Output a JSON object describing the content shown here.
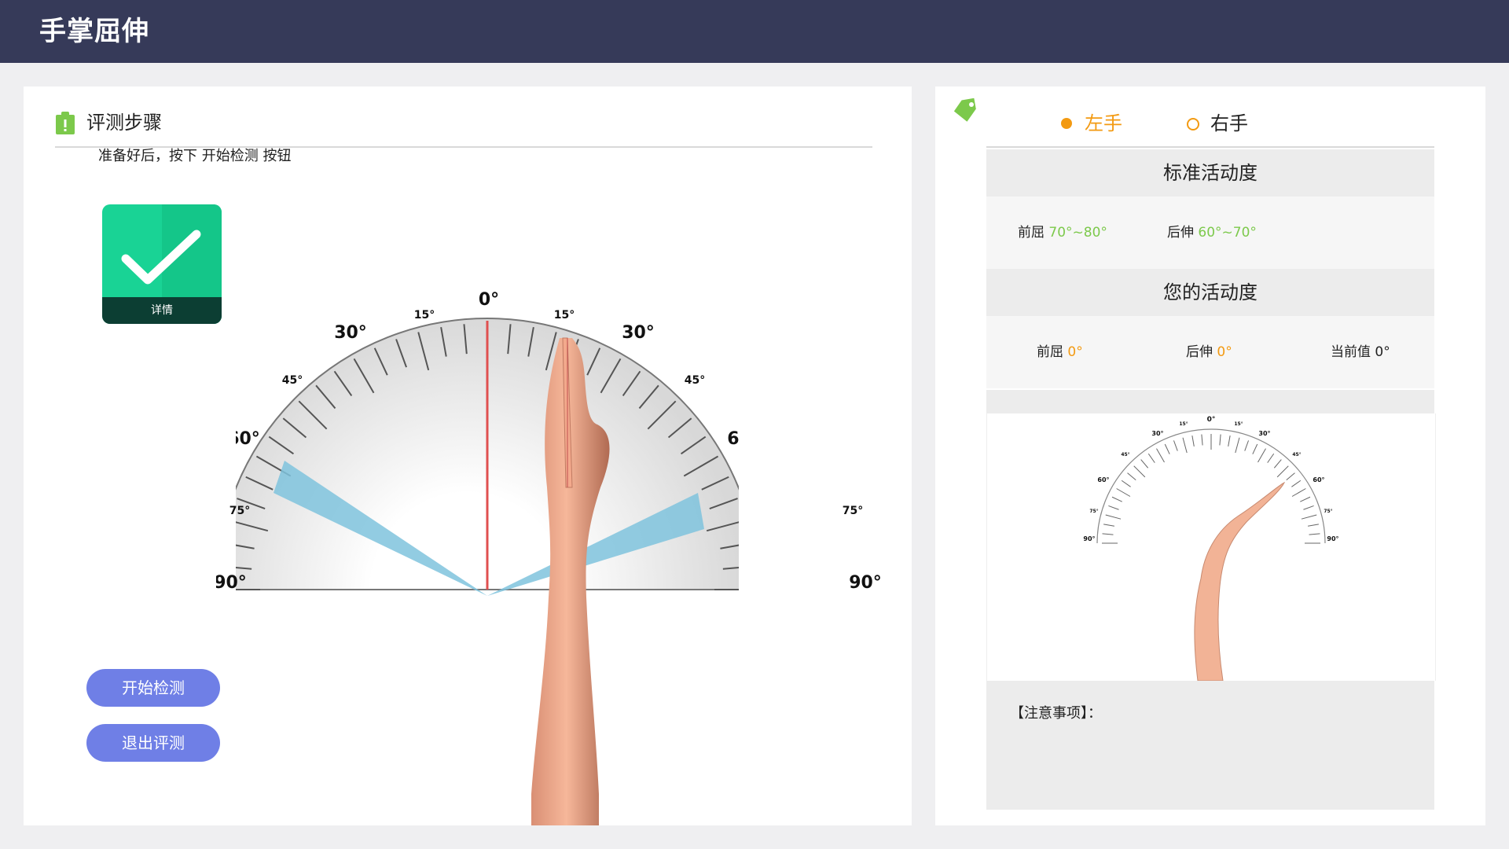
{
  "app": {
    "title": "手掌屈伸"
  },
  "steps": {
    "title": "评测步骤",
    "hint": "准备好后，按下 开始检测 按钮",
    "detail_label": "详情",
    "buttons": {
      "start": "开始检测",
      "exit": "退出评测"
    }
  },
  "gauge": {
    "labels": [
      "0°",
      "15°",
      "30°",
      "45°",
      "60°",
      "75°",
      "90°"
    ]
  },
  "hand_select": {
    "options": [
      {
        "label": "左手",
        "selected": true
      },
      {
        "label": "右手",
        "selected": false
      }
    ]
  },
  "standard": {
    "title": "标准活动度",
    "flexion_label": "前屈",
    "flexion_value": "70°~80°",
    "extension_label": "后伸",
    "extension_value": "60°~70°"
  },
  "yours": {
    "title": "您的活动度",
    "flexion_label": "前屈",
    "flexion_value": "0°",
    "extension_label": "后伸",
    "extension_value": "0°",
    "current_label": "当前值",
    "current_value": "0°"
  },
  "notes": {
    "title": "【注意事项】："
  },
  "colors": {
    "topbar": "#363a59",
    "accent_orange": "#f39a12",
    "accent_green": "#7cc94b",
    "button": "#6f7fe6",
    "zone_blue": "#7fc3dd"
  },
  "icons": [
    "clipboard-icon",
    "checkmark-icon",
    "tag-icon"
  ]
}
